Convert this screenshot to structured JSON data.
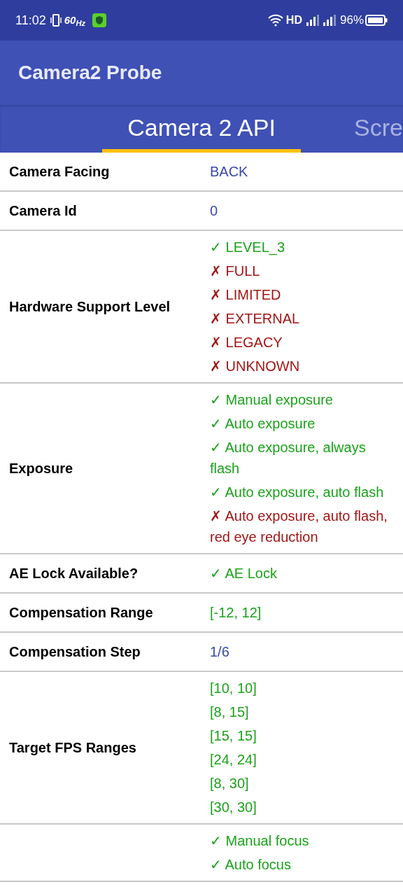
{
  "status_bar": {
    "time": "11:02",
    "refresh": "60$_{Hz}$",
    "network": "HD",
    "battery": "96%"
  },
  "app_bar": {
    "title": "Camera2 Probe"
  },
  "tabs": [
    {
      "label": "Camera 2 API",
      "selected": true
    },
    {
      "label": "Scre",
      "selected": false
    }
  ],
  "rows": [
    {
      "label": "Camera Facing",
      "values": [
        {
          "text": "BACK",
          "kind": "value"
        }
      ]
    },
    {
      "label": "Camera Id",
      "values": [
        {
          "text": "0",
          "kind": "value"
        }
      ]
    },
    {
      "label": "Hardware Support Level",
      "values": [
        {
          "text": "✓ LEVEL_3",
          "kind": "yes"
        },
        {
          "text": "✗ FULL",
          "kind": "no"
        },
        {
          "text": "✗ LIMITED",
          "kind": "no"
        },
        {
          "text": "✗ EXTERNAL",
          "kind": "no"
        },
        {
          "text": "✗ LEGACY",
          "kind": "no"
        },
        {
          "text": "✗ UNKNOWN",
          "kind": "no"
        }
      ]
    },
    {
      "label": "Exposure",
      "values": [
        {
          "text": "✓ Manual exposure",
          "kind": "yes"
        },
        {
          "text": "✓ Auto exposure",
          "kind": "yes"
        },
        {
          "text": "✓ Auto exposure, always flash",
          "kind": "yes"
        },
        {
          "text": "✓ Auto exposure, auto flash",
          "kind": "yes"
        },
        {
          "text": "✗ Auto exposure, auto flash, red eye reduction",
          "kind": "no"
        }
      ]
    },
    {
      "label": "AE Lock Available?",
      "values": [
        {
          "text": "✓ AE Lock",
          "kind": "yes"
        }
      ]
    },
    {
      "label": "Compensation Range",
      "values": [
        {
          "text": "[-12, 12]",
          "kind": "yes"
        }
      ]
    },
    {
      "label": "Compensation Step",
      "values": [
        {
          "text": "1/6",
          "kind": "value"
        }
      ]
    },
    {
      "label": "Target FPS Ranges",
      "values": [
        {
          "text": "[10, 10]",
          "kind": "yes"
        },
        {
          "text": "[8, 15]",
          "kind": "yes"
        },
        {
          "text": "[15, 15]",
          "kind": "yes"
        },
        {
          "text": "[24, 24]",
          "kind": "yes"
        },
        {
          "text": "[8, 30]",
          "kind": "yes"
        },
        {
          "text": "[30, 30]",
          "kind": "yes"
        }
      ]
    },
    {
      "values": [
        {
          "text": "✓ Manual focus",
          "kind": "yes"
        },
        {
          "text": "✓ Auto focus",
          "kind": "yes"
        }
      ]
    }
  ]
}
